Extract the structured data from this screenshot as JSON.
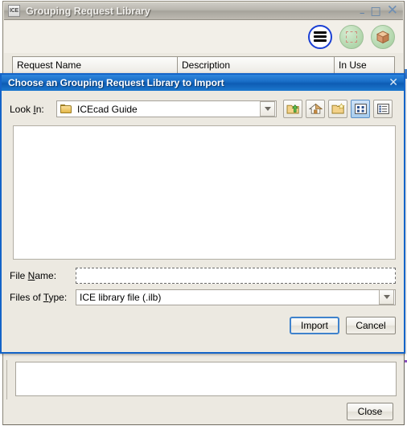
{
  "main_window": {
    "app_icon_text": "ICE",
    "title": "Grouping Request Library",
    "window_controls": {
      "minimize": "–",
      "maximize": "□",
      "close": "✕"
    },
    "toolbar_buttons": [
      {
        "name": "menu-button",
        "icon": "hamburger-menu-icon"
      },
      {
        "name": "marquee-select-button",
        "icon": "dashed-square-icon"
      },
      {
        "name": "box-3d-button",
        "icon": "cube-icon"
      }
    ],
    "table": {
      "columns": [
        "Request Name",
        "Description",
        "In Use"
      ],
      "rows": []
    },
    "close_label": "Close"
  },
  "dialog": {
    "title": "Choose an Grouping Request Library to Import",
    "close_glyph": "✕",
    "look_in": {
      "label_pre": "Look ",
      "label_accel": "I",
      "label_post": "n:",
      "value": "ICEcad Guide"
    },
    "toolbar": [
      {
        "name": "up-one-level-button",
        "icon": "folder-up-icon"
      },
      {
        "name": "home-button",
        "icon": "home-icon"
      },
      {
        "name": "create-new-folder-button",
        "icon": "new-folder-icon"
      },
      {
        "name": "list-view-button",
        "icon": "list-view-icon",
        "selected": true
      },
      {
        "name": "details-view-button",
        "icon": "details-view-icon",
        "selected": false
      }
    ],
    "file_list": {
      "items": []
    },
    "file_name": {
      "label_pre": "File ",
      "label_accel": "N",
      "label_post": "ame:",
      "value": "",
      "placeholder": ""
    },
    "files_of_type": {
      "label_pre": "Files of ",
      "label_accel": "T",
      "label_post": "ype:",
      "value": "ICE library file (.ilb)",
      "options": [
        "ICE library file (.ilb)"
      ]
    },
    "buttons": {
      "import_label": "Import",
      "cancel_label": "Cancel"
    }
  },
  "colors": {
    "dialog_border": "#1464c8",
    "dialog_titlebar": "#0e5cb4",
    "window_face": "#ece9e1",
    "accent_blue": "#1a3fd4",
    "green_button": "#aed4a8"
  }
}
